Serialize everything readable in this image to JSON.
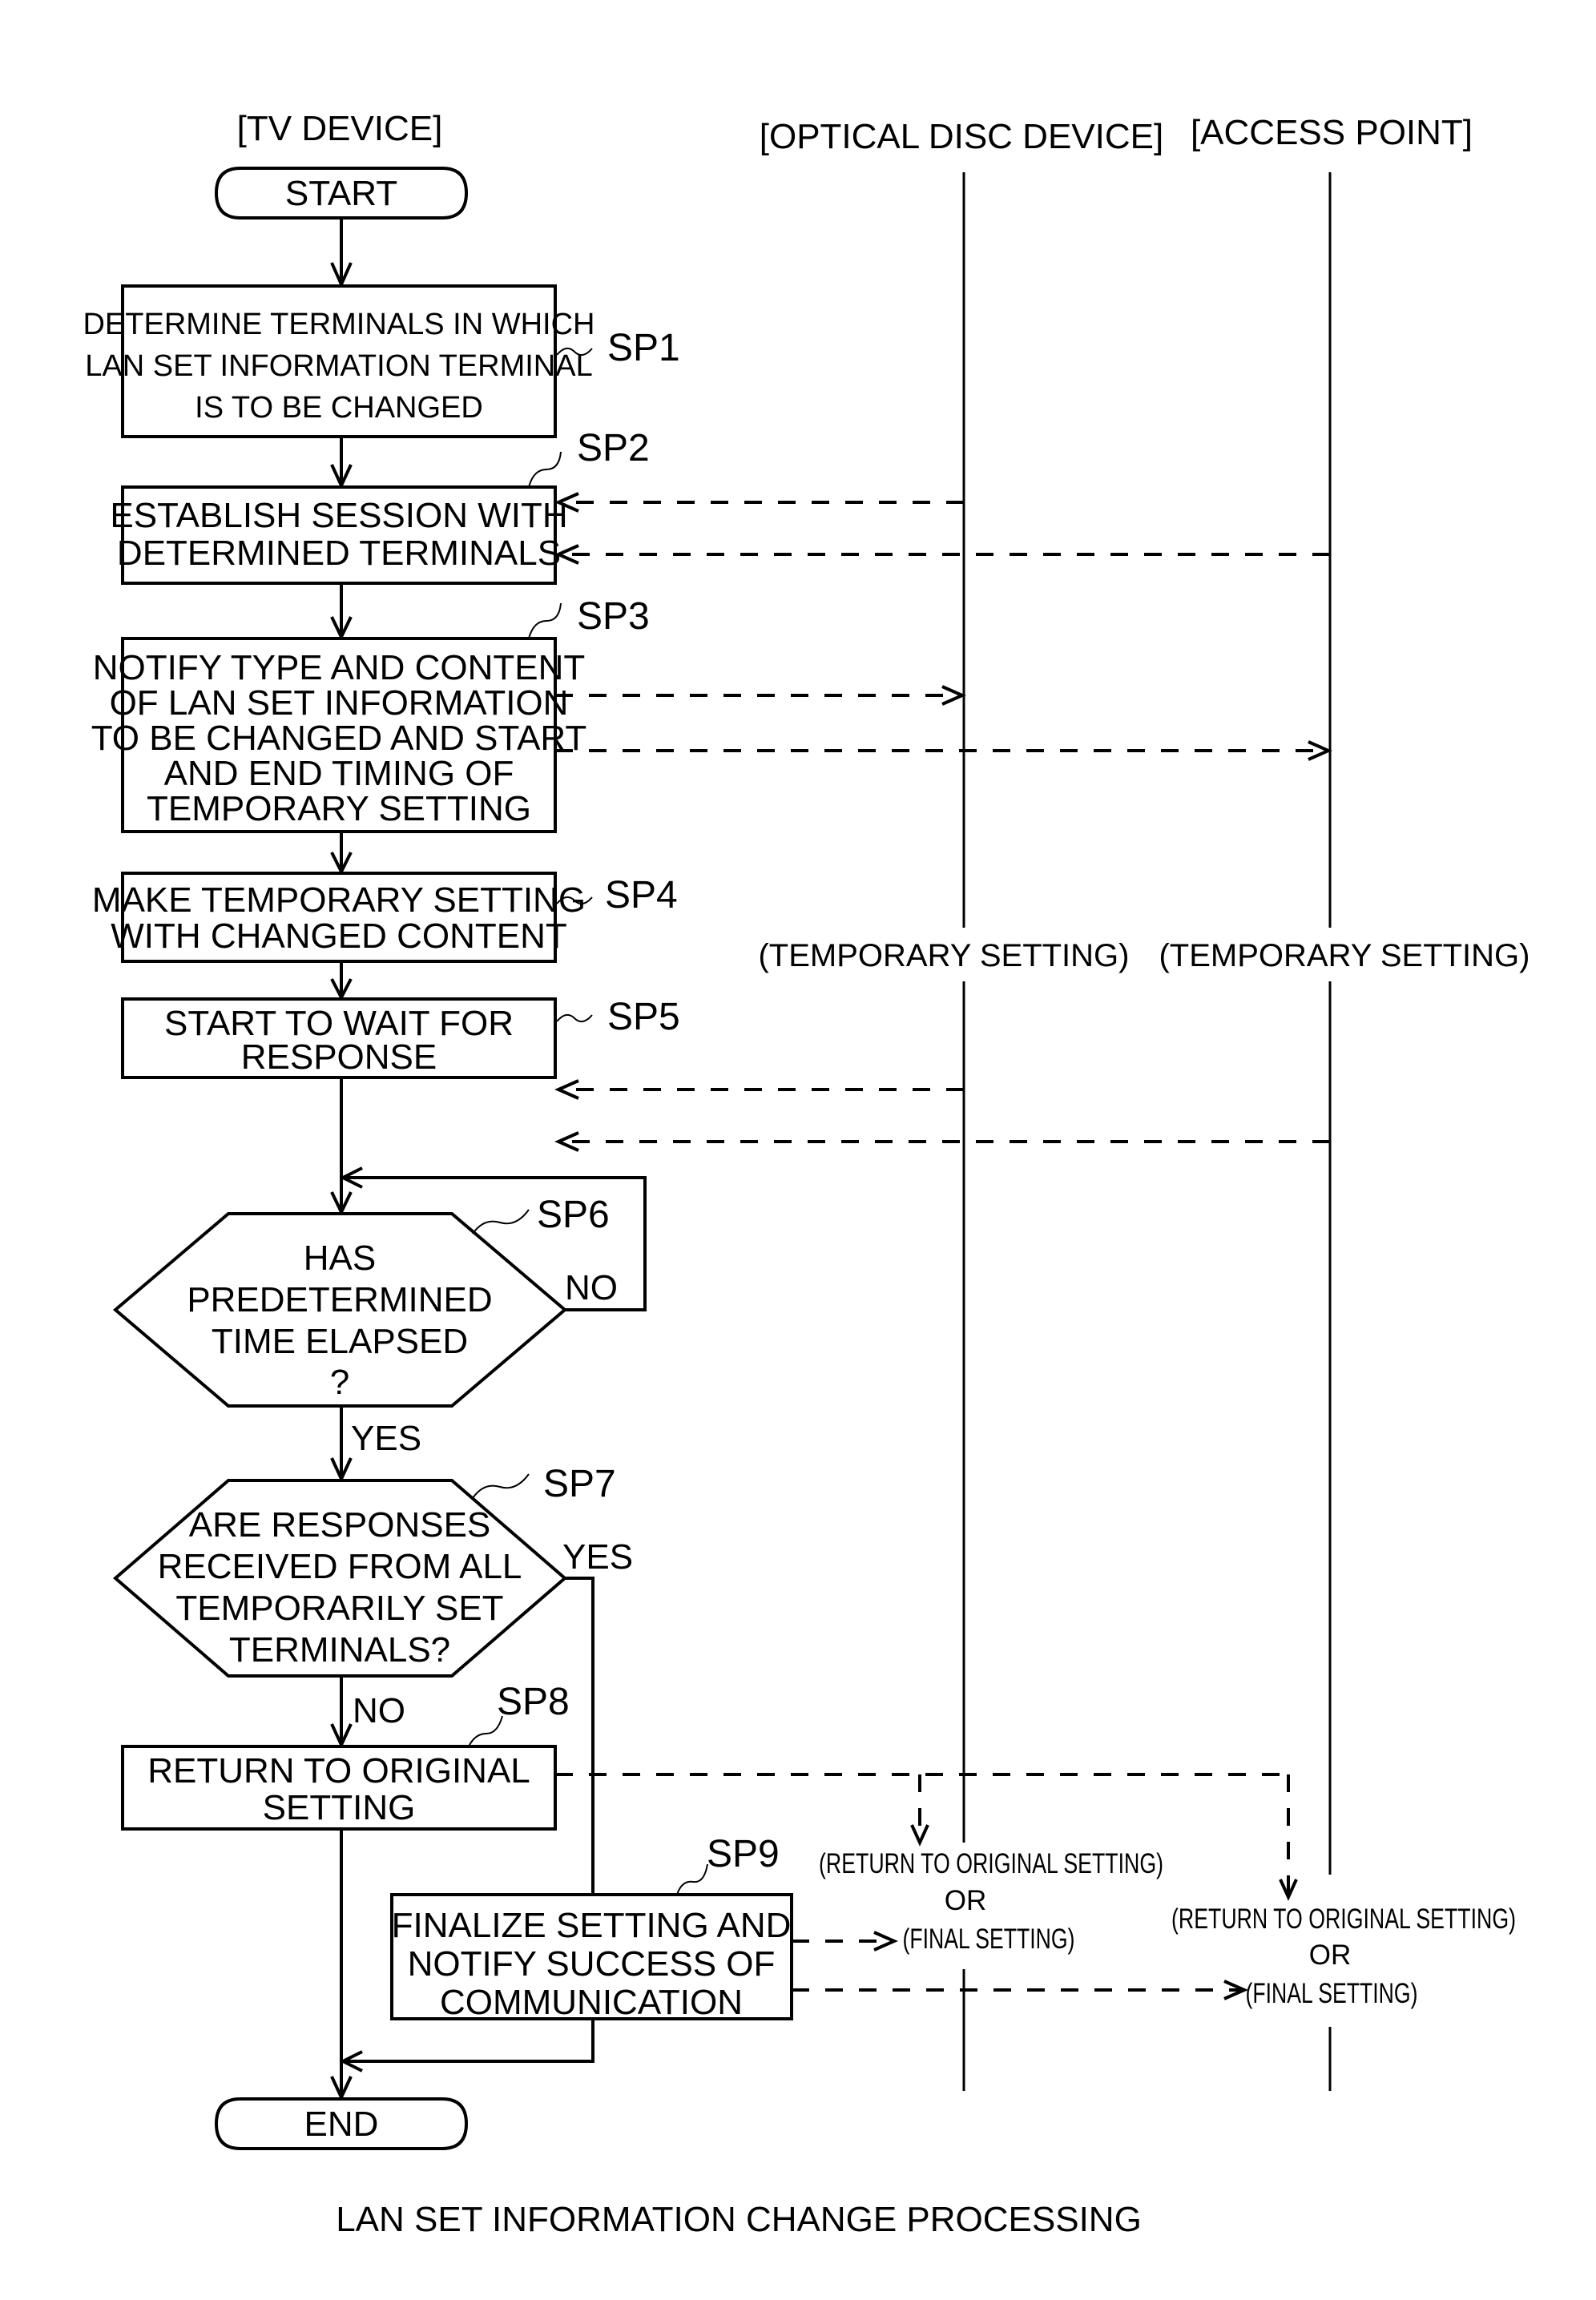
{
  "lanes": {
    "tv": "[TV DEVICE]",
    "optical": "[OPTICAL DISC DEVICE]",
    "access": "[ACCESS POINT]"
  },
  "terminals": {
    "start": "START",
    "end": "END"
  },
  "steps": {
    "sp1": {
      "id": "SP1",
      "lines": [
        "DETERMINE TERMINALS IN WHICH",
        "LAN SET INFORMATION TERMINAL",
        "IS TO BE CHANGED"
      ]
    },
    "sp2": {
      "id": "SP2",
      "lines": [
        "ESTABLISH SESSION WITH",
        "DETERMINED TERMINALS"
      ]
    },
    "sp3": {
      "id": "SP3",
      "lines": [
        "NOTIFY TYPE AND CONTENT",
        "OF LAN SET INFORMATION",
        "TO BE CHANGED AND START",
        "AND END TIMING OF",
        "TEMPORARY SETTING"
      ]
    },
    "sp4": {
      "id": "SP4",
      "lines": [
        "MAKE TEMPORARY SETTING",
        "WITH CHANGED CONTENT"
      ]
    },
    "sp5": {
      "id": "SP5",
      "lines": [
        "START TO WAIT FOR",
        "RESPONSE"
      ]
    },
    "sp6": {
      "id": "SP6",
      "lines": [
        "HAS",
        "PREDETERMINED",
        "TIME ELAPSED",
        "?"
      ],
      "yes": "YES",
      "no": "NO"
    },
    "sp7": {
      "id": "SP7",
      "lines": [
        "ARE RESPONSES",
        "RECEIVED FROM ALL",
        "TEMPORARILY SET",
        "TERMINALS?"
      ],
      "yes": "YES",
      "no": "NO"
    },
    "sp8": {
      "id": "SP8",
      "lines": [
        "RETURN TO ORIGINAL",
        "SETTING"
      ]
    },
    "sp9": {
      "id": "SP9",
      "lines": [
        "FINALIZE SETTING AND",
        "NOTIFY SUCCESS OF",
        "COMMUNICATION"
      ]
    }
  },
  "notes": {
    "optical_temp": "(TEMPORARY SETTING)",
    "access_temp": "(TEMPORARY SETTING)",
    "optical_final": [
      "(RETURN TO ORIGINAL SETTING)",
      "OR",
      "(FINAL SETTING)"
    ],
    "access_final": [
      "(RETURN TO ORIGINAL SETTING)",
      "OR",
      "(FINAL SETTING)"
    ]
  },
  "caption": "LAN SET INFORMATION CHANGE PROCESSING"
}
